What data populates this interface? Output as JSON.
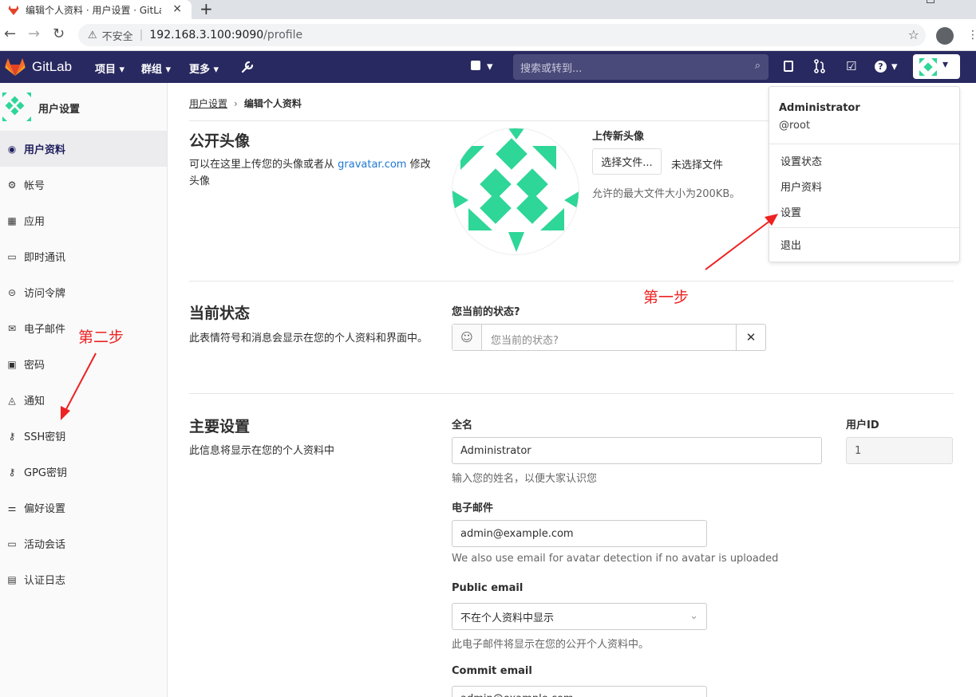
{
  "browser": {
    "tab_title": "编辑个人资料 · 用户设置 · GitLab",
    "tab_close": "×",
    "new_tab": "+",
    "insecure_label": "不安全",
    "url_host": "192.168.3.100:9090",
    "url_path": "/profile"
  },
  "header": {
    "brand": "GitLab",
    "nav": [
      "项目 ▾",
      "群组 ▾",
      "更多 ▾"
    ],
    "search_placeholder": "搜索或转到...",
    "accent": "#292961"
  },
  "sidebar": {
    "title": "用户设置",
    "items": [
      {
        "label": "用户资料",
        "icon": "user-circle-icon",
        "active": true
      },
      {
        "label": "帐号",
        "icon": "account-gear-icon"
      },
      {
        "label": "应用",
        "icon": "grid-apps-icon"
      },
      {
        "label": "即时通讯",
        "icon": "chat-icon"
      },
      {
        "label": "访问令牌",
        "icon": "token-icon"
      },
      {
        "label": "电子邮件",
        "icon": "envelope-icon"
      },
      {
        "label": "密码",
        "icon": "lock-icon"
      },
      {
        "label": "通知",
        "icon": "bell-icon"
      },
      {
        "label": "SSH密钥",
        "icon": "key-icon"
      },
      {
        "label": "GPG密钥",
        "icon": "key-icon"
      },
      {
        "label": "偏好设置",
        "icon": "sliders-icon"
      },
      {
        "label": "活动会话",
        "icon": "monitor-icon"
      },
      {
        "label": "认证日志",
        "icon": "log-icon"
      }
    ]
  },
  "breadcrumb": {
    "parent": "用户设置",
    "separator": "›",
    "current": "编辑个人资料"
  },
  "avatar_section": {
    "title": "公开头像",
    "desc_before": "可以在这里上传您的头像或者从 ",
    "desc_link": "gravatar.com",
    "desc_after": " 修改头像",
    "upload_label": "上传新头像",
    "choose_button": "选择文件...",
    "no_file": "未选择文件",
    "size_hint": "允许的最大文件大小为200KB。",
    "avatar_color": "#2ed698"
  },
  "status_section": {
    "title": "当前状态",
    "desc": "此表情符号和消息会显示在您的个人资料和界面中。",
    "label": "您当前的状态?",
    "placeholder": "您当前的状态?",
    "clear": "✕"
  },
  "main_section": {
    "title": "主要设置",
    "desc": "此信息将显示在您的个人资料中",
    "fullname_label": "全名",
    "fullname_value": "Administrator",
    "fullname_help": "输入您的姓名，以便大家认识您",
    "userid_label": "用户ID",
    "userid_value": "1",
    "email_label": "电子邮件",
    "email_value": "admin@example.com",
    "email_help": "We also use email for avatar detection if no avatar is uploaded",
    "public_email_label": "Public email",
    "public_email_value": "不在个人资料中显示",
    "public_email_help": "此电子邮件将显示在您的公开个人资料中。",
    "commit_email_label": "Commit email",
    "commit_email_value": "admin@example.com"
  },
  "user_menu": {
    "name": "Administrator",
    "username": "@root",
    "items": [
      "设置状态",
      "用户资料",
      "设置"
    ],
    "signout": "退出"
  },
  "annotations": {
    "step1": "第一步",
    "step2": "第二步",
    "color": "#ee2222"
  }
}
